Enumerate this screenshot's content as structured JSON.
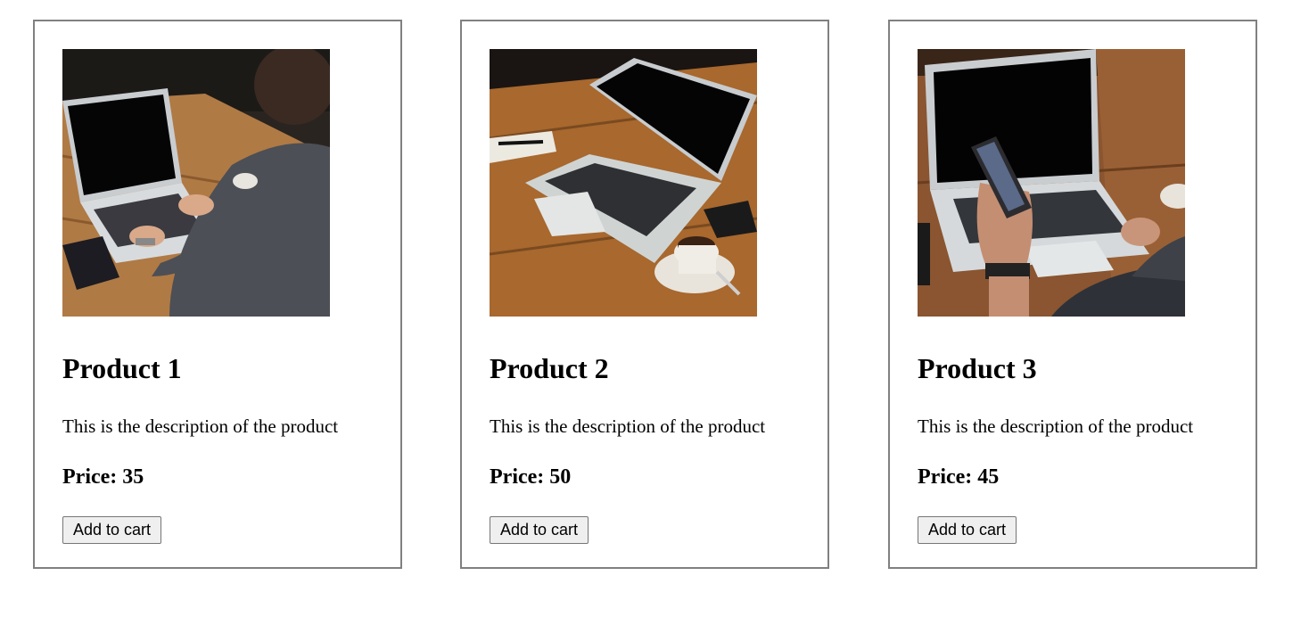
{
  "colors": {
    "card_border": "#808080",
    "button_background": "#efefef",
    "button_border": "#767676"
  },
  "products": [
    {
      "title": "Product 1",
      "description": "This is the description of the product",
      "price_label": "Price: ",
      "price": "35",
      "button_label": "Add to cart",
      "image_subject": "person typing on laptop at wooden table"
    },
    {
      "title": "Product 2",
      "description": "This is the description of the product",
      "price_label": "Price: ",
      "price": "50",
      "button_label": "Add to cart",
      "image_subject": "laptop with coffee cup on wooden table"
    },
    {
      "title": "Product 3",
      "description": "This is the description of the product",
      "price_label": "Price: ",
      "price": "45",
      "button_label": "Add to cart",
      "image_subject": "hand holding phone in front of laptop"
    }
  ]
}
